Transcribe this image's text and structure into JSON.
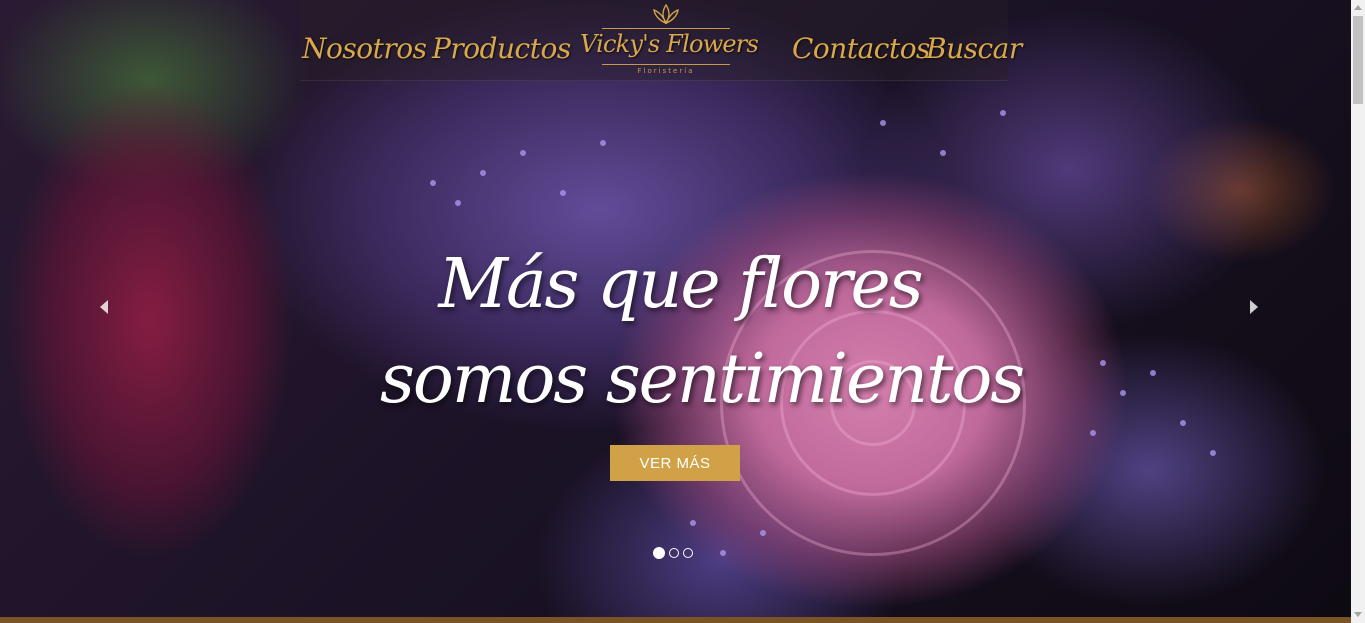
{
  "nav": {
    "left": [
      {
        "label": "Nosotros"
      },
      {
        "label": "Productos"
      }
    ],
    "brand": {
      "name": "Vicky's Flowers",
      "tagline": "Floristería"
    },
    "right": [
      {
        "label": "Contactos"
      },
      {
        "label": "Buscar"
      }
    ]
  },
  "hero": {
    "headline_line1": "Más que flores",
    "headline_line2": "somos sentimientos",
    "cta_label": "VER MÁS",
    "slides": {
      "count": 3,
      "active": 1
    },
    "prev_icon": "chevron-left-icon",
    "next_icon": "chevron-right-icon"
  },
  "colors": {
    "accent_gold": "#d0a146",
    "nav_text": "#d8a84a",
    "headline_text": "#ffffff"
  }
}
